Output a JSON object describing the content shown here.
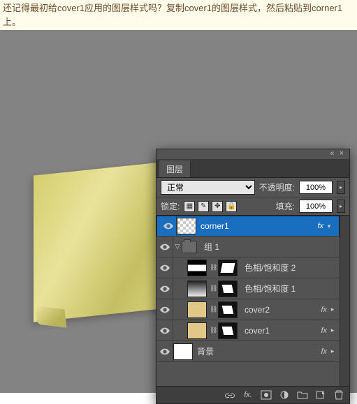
{
  "instruction": "还记得最初给cover1应用的图层样式吗？复制cover1的图层样式，然后粘贴到corner1上。",
  "panel": {
    "tab": "图层",
    "blend_mode": "正常",
    "opacity_label": "不透明度:",
    "opacity_value": "100%",
    "lock_label": "锁定:",
    "fill_label": "填充:",
    "fill_value": "100%"
  },
  "layers": [
    {
      "id": "corner1",
      "name": "corner1",
      "fx": "fx",
      "selected": true,
      "thumb": "trans",
      "depth": 0
    },
    {
      "id": "group1",
      "name": "组 1",
      "type": "group",
      "depth": 0
    },
    {
      "id": "hue2",
      "name": "色相/饱和度 2",
      "thumb": "grad",
      "mask": "m1",
      "depth": 1
    },
    {
      "id": "hue1",
      "name": "色相/饱和度 1",
      "thumb": "grad2",
      "mask": "m2",
      "depth": 1
    },
    {
      "id": "cover2",
      "name": "cover2",
      "thumb": "tan",
      "mask": "m2",
      "fx": "fx",
      "depth": 1
    },
    {
      "id": "cover1",
      "name": "cover1",
      "thumb": "tan",
      "mask": "m2",
      "fx": "fx",
      "depth": 1
    },
    {
      "id": "bg",
      "name": "背景",
      "thumb": "white",
      "fx": "fx",
      "depth": 0
    }
  ]
}
